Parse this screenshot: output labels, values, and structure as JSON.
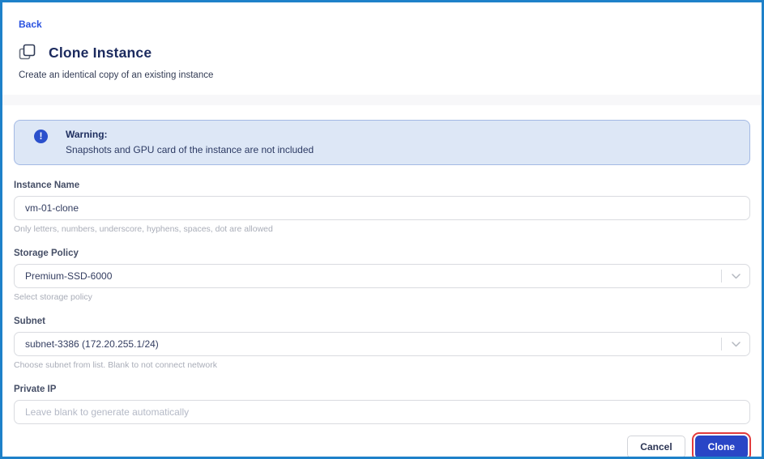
{
  "page": {
    "back_label": "Back",
    "title": "Clone Instance",
    "subtitle": "Create an identical copy of an existing instance"
  },
  "warning": {
    "icon": "info-exclamation-icon",
    "title": "Warning:",
    "message": "Snapshots and GPU card of the instance are not included"
  },
  "form": {
    "fields": [
      {
        "label": "Instance Name",
        "type": "input",
        "value": "vm-01-clone",
        "helper": "Only letters, numbers, underscore, hyphens, spaces, dot are allowed"
      },
      {
        "label": "Storage Policy",
        "type": "select",
        "value": "Premium-SSD-6000",
        "helper": "Select storage policy"
      },
      {
        "label": "Subnet",
        "type": "select",
        "value": "subnet-3386 (172.20.255.1/24)",
        "helper": "Choose subnet from list. Blank to not connect network"
      },
      {
        "label": "Private IP",
        "type": "input",
        "value": "",
        "placeholder": "Leave blank to generate automatically",
        "helper": ""
      }
    ]
  },
  "footer": {
    "cancel_label": "Cancel",
    "clone_label": "Clone"
  },
  "colors": {
    "frame_border": "#1e81c9",
    "link_blue": "#2a52e0",
    "title_navy": "#1b2a5e",
    "warning_bg": "#dde7f6",
    "warning_border": "#a3b9e4",
    "warning_icon_bg": "#2b50cc",
    "primary_button": "#2946c6",
    "highlight_red": "#e23b3c"
  }
}
